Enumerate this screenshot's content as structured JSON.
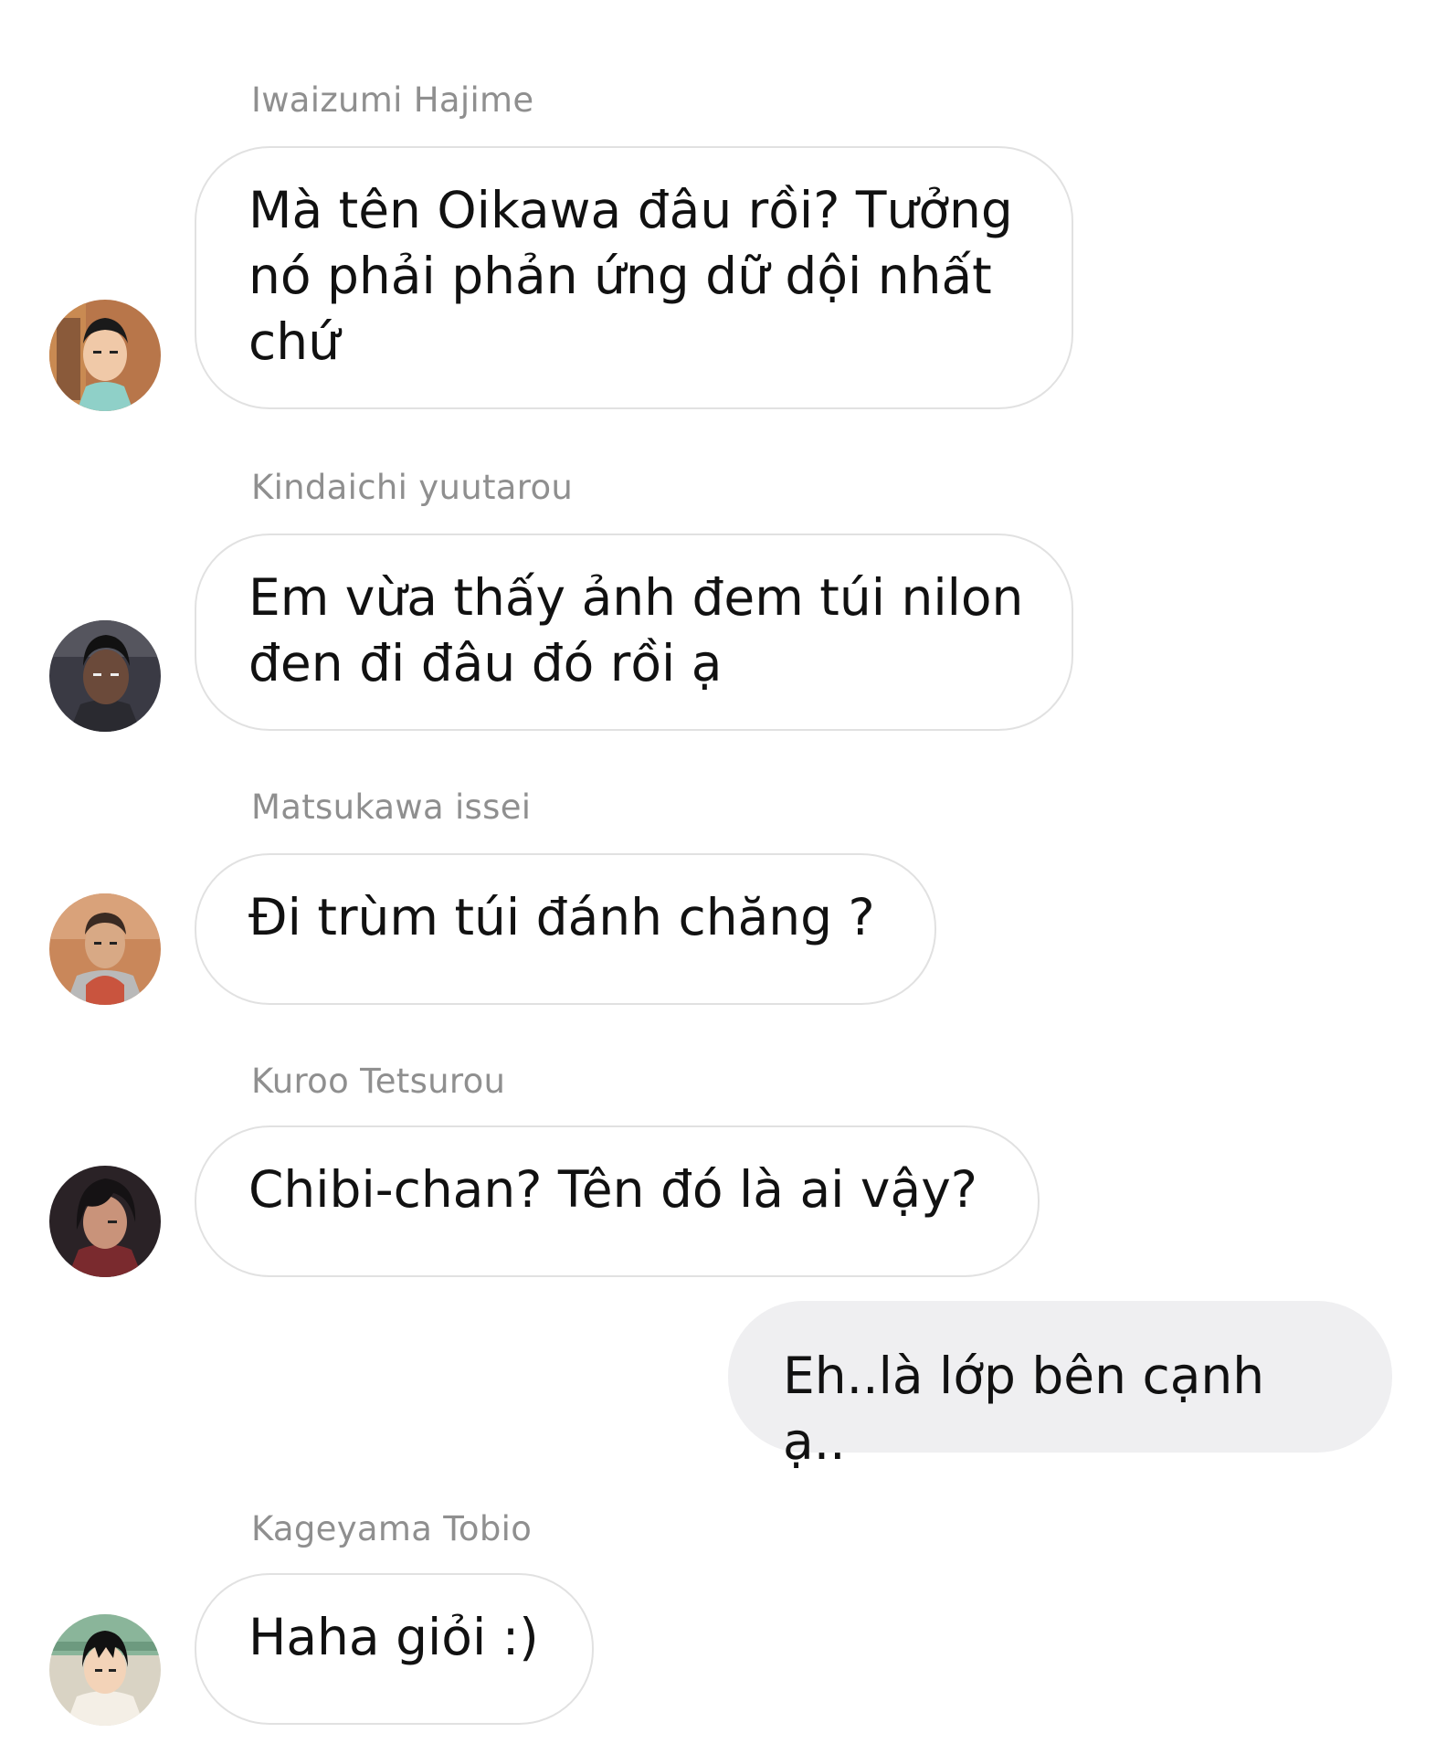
{
  "messages": [
    {
      "sender": "Iwaizumi Hajime",
      "text": "Mà tên Oikawa đâu rồi? Tưởng nó phải phản ứng dữ dội nhất chứ",
      "avatar": "iwaizumi-avatar"
    },
    {
      "sender": "Kindaichi yuutarou",
      "text": "Em vừa thấy ảnh đem túi nilon đen đi đâu đó rồi ạ",
      "avatar": "kindaichi-avatar"
    },
    {
      "sender": "Matsukawa issei",
      "text": "Đi trùm túi đánh chăng ?",
      "avatar": "matsukawa-avatar"
    },
    {
      "sender": "Kuroo Tetsurou",
      "text": "Chibi-chan? Tên đó là ai vậy?",
      "avatar": "kuroo-avatar"
    },
    {
      "sender": "me",
      "text": "Eh..là lớp bên cạnh ạ..",
      "outgoing": true
    },
    {
      "sender": "Kageyama Tobio",
      "text": "Haha giỏi :)",
      "avatar": "kageyama-avatar"
    }
  ],
  "colors": {
    "sender_name": "#8f8f8f",
    "incoming_bubble_border": "#e1e1e1",
    "outgoing_bubble_bg": "#efeff1",
    "text": "#111111"
  }
}
